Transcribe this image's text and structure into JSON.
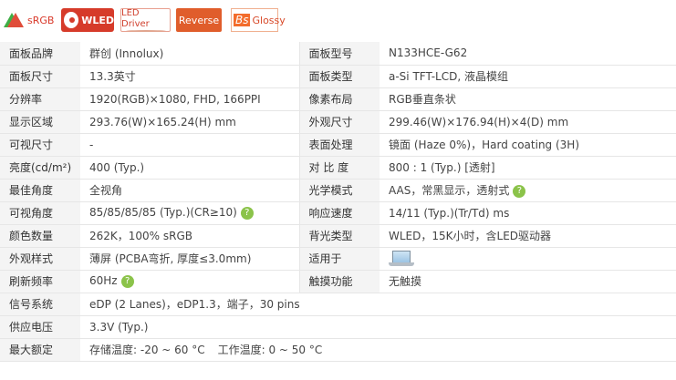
{
  "badges": {
    "srgb": "sRGB",
    "wled": "WLED",
    "led_driver": "LED Driver",
    "reverse": "Reverse",
    "glossy_prefix": "Bs",
    "glossy": "Glossy"
  },
  "rows": [
    {
      "l1": "面板品牌",
      "v1": "群创 (Innolux)",
      "l2": "面板型号",
      "v2": "N133HCE-G62"
    },
    {
      "l1": "面板尺寸",
      "v1": "13.3英寸",
      "l2": "面板类型",
      "v2": "a-Si TFT-LCD, 液晶模组"
    },
    {
      "l1": "分辨率",
      "v1": "1920(RGB)×1080, FHD, 166PPI",
      "l2": "像素布局",
      "v2": "RGB垂直条状"
    },
    {
      "l1": "显示区域",
      "v1": "293.76(W)×165.24(H) mm",
      "l2": "外观尺寸",
      "v2": "299.46(W)×176.94(H)×4(D) mm"
    },
    {
      "l1": "可视尺寸",
      "v1": "-",
      "l2": "表面处理",
      "v2": "镜面 (Haze 0%)，Hard coating (3H)"
    },
    {
      "l1": "亮度(cd/m²)",
      "v1": "400 (Typ.)",
      "l2": "对 比 度",
      "v2": "800 : 1 (Typ.) [透射]"
    },
    {
      "l1": "最佳角度",
      "v1": "全视角",
      "l2": "光学模式",
      "v2": "AAS，常黑显示，透射式"
    },
    {
      "l1": "可视角度",
      "v1": "85/85/85/85 (Typ.)(CR≥10)",
      "l2": "响应速度",
      "v2": "14/11 (Typ.)(Tr/Td) ms"
    },
    {
      "l1": "颜色数量",
      "v1": "262K，100% sRGB",
      "l2": "背光类型",
      "v2": "WLED，15K小时，含LED驱动器"
    },
    {
      "l1": "外观样式",
      "v1": "薄屏 (PCBA弯折, 厚度≤3.0mm)",
      "l2": "适用于",
      "v2": ""
    },
    {
      "l1": "刷新频率",
      "v1": "60Hz",
      "l2": "触摸功能",
      "v2": "无触摸"
    }
  ],
  "full_rows": [
    {
      "label": "信号系统",
      "value": "eDP (2 Lanes)，eDP1.3，端子，30 pins"
    },
    {
      "label": "供应电压",
      "value": "3.3V (Typ.)"
    }
  ],
  "rating": {
    "label": "最大额定",
    "storage": "存储温度: -20 ~ 60 °C",
    "operating": "工作温度: 0 ~ 50 °C"
  },
  "help_glyph": "?",
  "icons": {
    "help": "help-circle-icon",
    "laptop": "laptop-icon"
  }
}
